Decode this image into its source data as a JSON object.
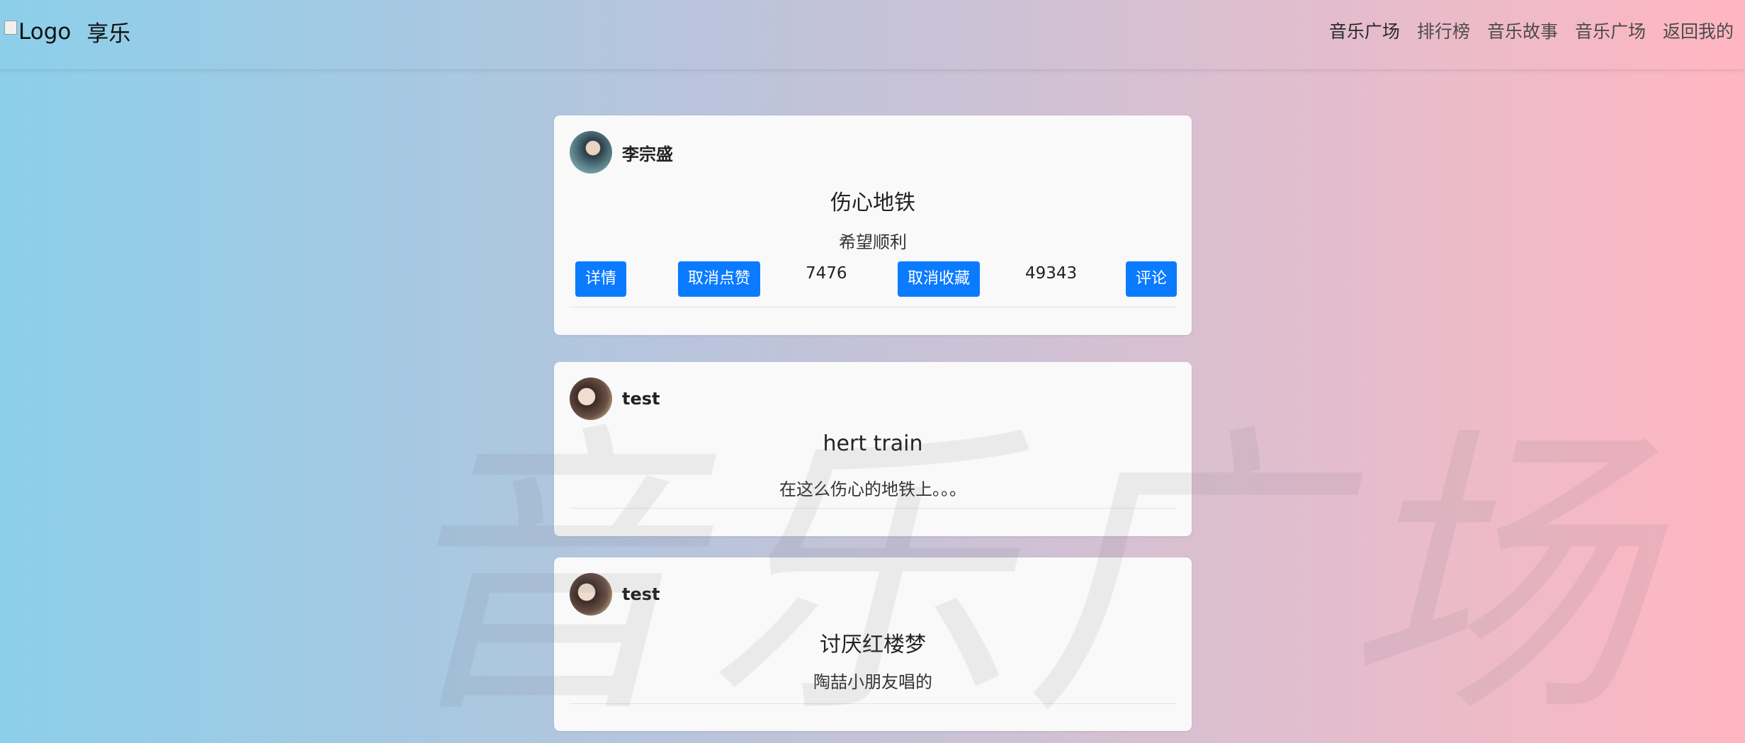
{
  "navbar": {
    "logo_alt": "Logo",
    "brand": "享乐",
    "links": [
      "音乐广场",
      "排行榜",
      "音乐故事",
      "音乐广场",
      "返回我的"
    ]
  },
  "watermark": "音乐广场",
  "posts": [
    {
      "author": "李宗盛",
      "title": "伤心地铁",
      "subtitle": "希望顺利",
      "actions": {
        "detail": "详情",
        "unlike": "取消点赞",
        "like_count": "7476",
        "unfavorite": "取消收藏",
        "favorite_count": "49343",
        "comment": "评论"
      }
    },
    {
      "author": "test",
      "title": "hert train",
      "subtitle": "在这么伤心的地铁上。。。"
    },
    {
      "author": "test",
      "title": "讨厌红楼梦",
      "subtitle": "陶喆小朋友唱的"
    }
  ],
  "colors": {
    "gradient_left": "#8ccfea",
    "gradient_right": "#ffb6c1",
    "button": "#0a7bff"
  }
}
